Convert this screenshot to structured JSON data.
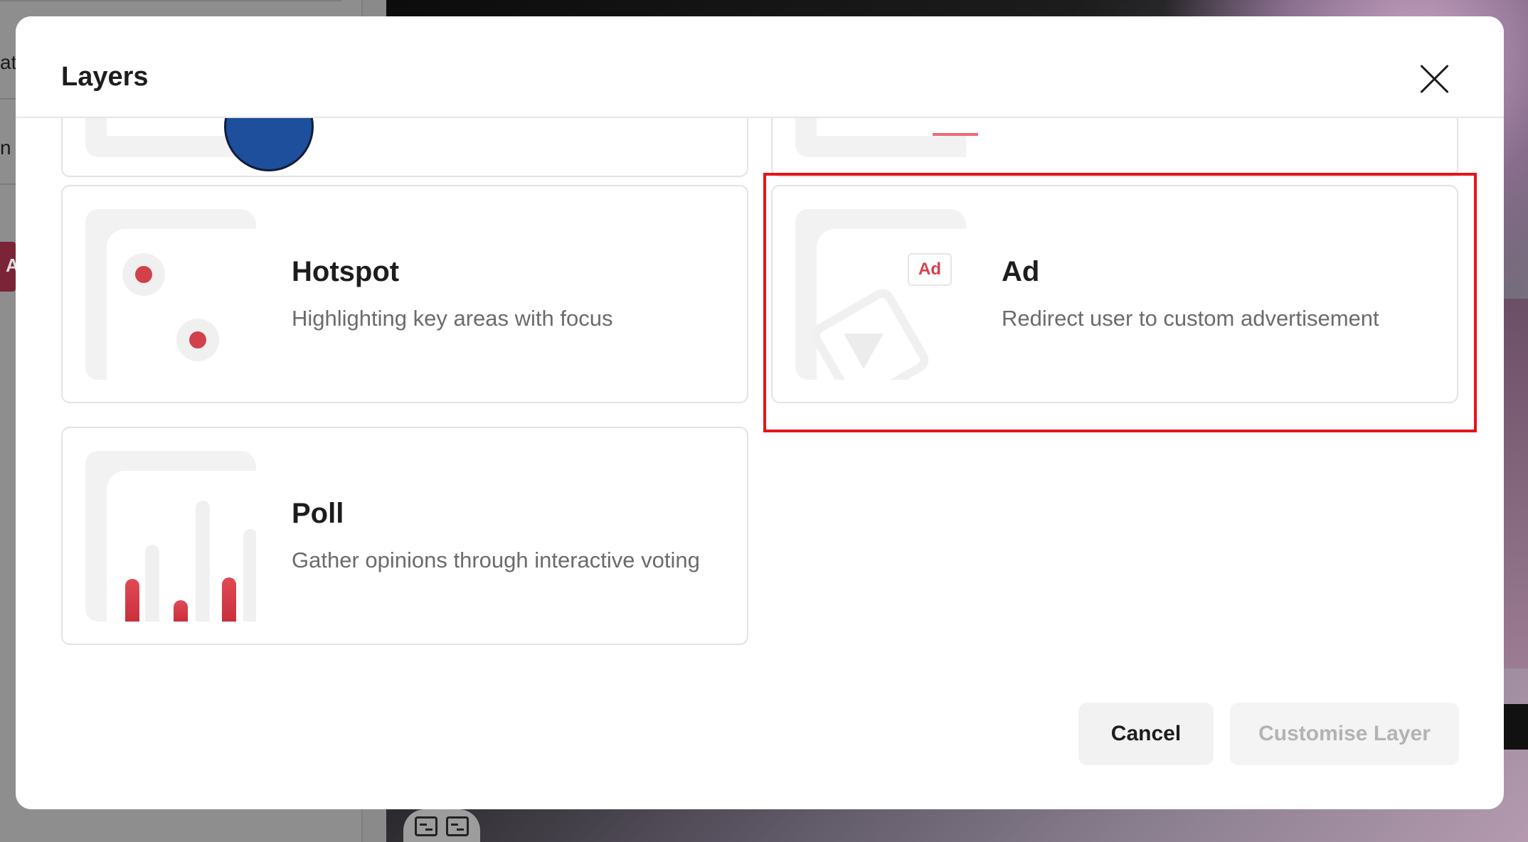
{
  "background": {
    "left_panel_fragments": [
      "at",
      "n l"
    ],
    "red_tab_letter": "A"
  },
  "modal": {
    "title": "Layers",
    "cards": [
      {
        "id": "hotspot",
        "title": "Hotspot",
        "description": "Highlighting key areas with focus",
        "icon": "hotspot-icon"
      },
      {
        "id": "ad",
        "title": "Ad",
        "description": "Redirect user to custom advertisement",
        "icon": "ad-icon",
        "badge": "Ad",
        "highlighted": true
      },
      {
        "id": "poll",
        "title": "Poll",
        "description": "Gather opinions through interactive voting",
        "icon": "poll-icon"
      }
    ],
    "buttons": {
      "cancel": "Cancel",
      "customise": "Customise Layer"
    }
  },
  "colors": {
    "accent_red": "#d2404b",
    "highlight_border": "#e3151b",
    "disabled_text": "#b3b3b3"
  }
}
